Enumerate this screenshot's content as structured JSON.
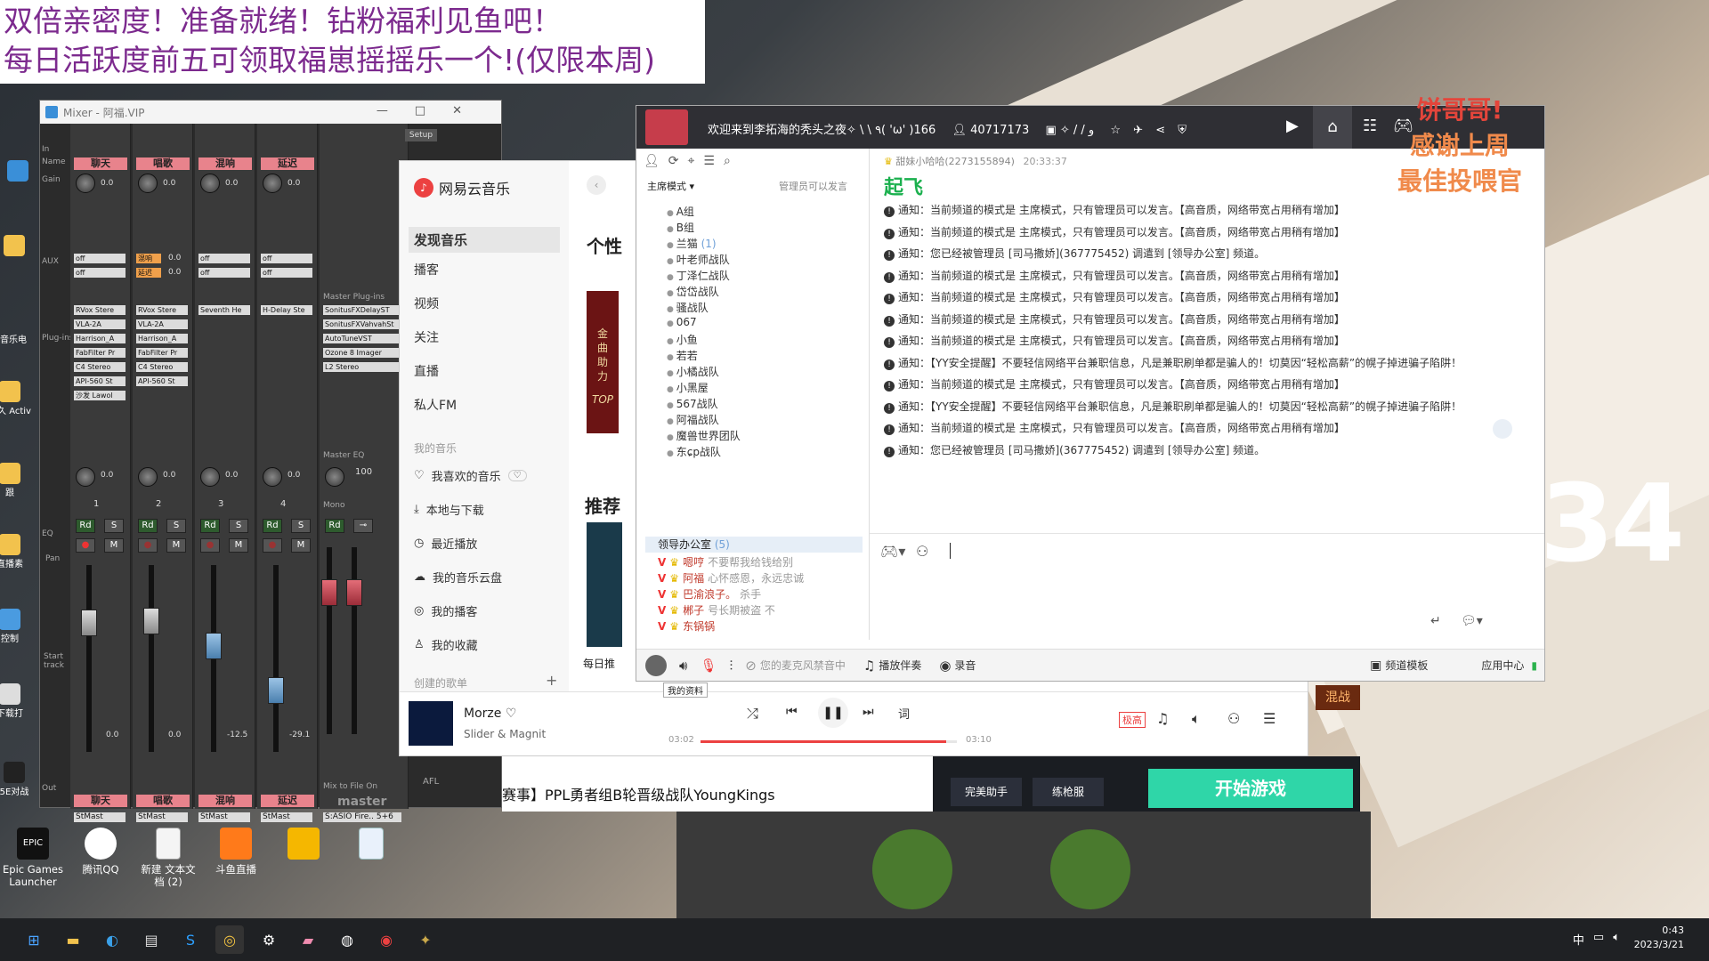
{
  "banner": {
    "line1": "双倍亲密度！准备就绪！钻粉福利见鱼吧！",
    "line2": "每日活跃度前五可领取福崽摇摇乐一个!(仅限本周)"
  },
  "overlay": {
    "line1": "饼哥哥!",
    "line2": "感谢上周",
    "line3": "最佳投喂官",
    "big_number": "34"
  },
  "desktop_icons": [
    {
      "label": "Epic Games Launcher",
      "icon": "epic-icon"
    },
    {
      "label": "腾讯QQ",
      "icon": "qq-icon"
    },
    {
      "label": "新建 文本文档 (2)",
      "icon": "text-file-icon"
    },
    {
      "label": "斗鱼直播",
      "icon": "douyu-icon"
    }
  ],
  "left_edge_labels": [
    "音乐电",
    "永久 Activ",
    "跟",
    "直播素",
    "控制",
    "下载打",
    "5E对战"
  ],
  "mixer": {
    "title": "Mixer - 阿福.VIP",
    "setup_label": "Setup",
    "row_labels": {
      "in": "In",
      "name": "Name",
      "gain": "Gain",
      "aux": "AUX",
      "plugins": "Plug-ins",
      "eq": "EQ",
      "pan": "Pan",
      "start_track": "Start track",
      "out": "Out"
    },
    "channels": [
      {
        "name": "聊天",
        "gain": "0.0",
        "aux": [
          "off",
          "off"
        ],
        "plugins": [
          "RVox Stere",
          "VLA-2A",
          "Harrison_A",
          "FabFilter Pr",
          "C4 Stereo",
          "API-560 St",
          "沙发 Lawol"
        ],
        "pan": "0.0",
        "num": "1",
        "level": "0.0",
        "out": "StMast"
      },
      {
        "name": "唱歌",
        "gain": "0.0",
        "aux": [
          "混响",
          "延迟"
        ],
        "aux_vals": [
          "0.0",
          "0.0"
        ],
        "plugins": [
          "RVox Stere",
          "VLA-2A",
          "Harrison_A",
          "FabFilter Pr",
          "C4 Stereo",
          "API-560 St"
        ],
        "pan": "0.0",
        "num": "2",
        "level": "0.0",
        "out": "StMast"
      },
      {
        "name": "混响",
        "gain": "0.0",
        "aux": [
          "off",
          "off"
        ],
        "plugins": [
          "Seventh He"
        ],
        "pan": "0.0",
        "num": "3",
        "level": "-12.5",
        "out": "StMast"
      },
      {
        "name": "延迟",
        "gain": "0.0",
        "aux": [
          "off",
          "off"
        ],
        "plugins": [
          "H-Delay Ste"
        ],
        "pan": "0.0",
        "num": "4",
        "level": "-29.1",
        "out": "StMast"
      }
    ],
    "master": {
      "plugins_label": "Master Plug-ins",
      "plugins": [
        "SonitusFXDelayST",
        "SonitusFXVahvahSt",
        "AutoTuneVST",
        "Ozone 8 Imager",
        "L2 Stereo"
      ],
      "eq_label": "Master EQ",
      "pan": "100",
      "mono_label": "Mono",
      "name": "master",
      "out": "S:ASIO Fire.. 5+6",
      "afl": "AFL",
      "mix_label": "Mix to File  On"
    }
  },
  "netease": {
    "logo": "网易云音乐",
    "nav": [
      "发现音乐",
      "播客",
      "视频",
      "关注",
      "直播",
      "私人FM"
    ],
    "my_music_label": "我的音乐",
    "my_music": [
      "我喜欢的音乐",
      "本地与下载",
      "最近播放",
      "我的音乐云盘",
      "我的播客",
      "我的收藏"
    ],
    "created_label": "创建的歌单",
    "main_heading_1": "个性",
    "main_heading_2": "推荐",
    "daily_label": "每日推",
    "promo_text": [
      "金",
      "曲",
      "助",
      "力"
    ],
    "promo_top": "TOP",
    "player": {
      "track": "Morze",
      "artist": "Slider & Magnit",
      "time_current": "03:02",
      "time_total": "03:10",
      "progress": 0.958,
      "quality": "极高",
      "lyrics_label": "词"
    }
  },
  "yy": {
    "title": "欢迎来到李拓海的秃头之夜✧ \\ \\ ٩( 'ω' )و / / ✧",
    "room_id": "40717173",
    "users": "166",
    "mode_label": "主席模式",
    "admin_only": "管理员可以发言",
    "channels": [
      "A组",
      "B组",
      "兰猫",
      "叶老师战队",
      "丁泽仁战队",
      "岱岱战队",
      "骚战队",
      "067",
      "小鱼",
      "若若",
      "小橘战队",
      "小黑屋",
      "567战队",
      "阿福战队",
      "魔兽世界团队",
      "东ɕp战队"
    ],
    "channel_counts": {
      "兰猫": "(1)"
    },
    "office": {
      "name": "领导办公室",
      "count": "(5)"
    },
    "members": [
      {
        "name": "嗯哼",
        "note": "不要帮我给钱给别"
      },
      {
        "name": "阿福",
        "note": "心怀感恩，永远忠诚"
      },
      {
        "name": "巴渝浪子。",
        "note": "杀手"
      },
      {
        "name": "郴子",
        "note": "号长期被盗 不"
      },
      {
        "name": "东锅锅",
        "note": ""
      }
    ],
    "chat": {
      "sender": "甜妹小哈哈(2273155894)",
      "time": "20:33:37",
      "message": "起飞",
      "notices": [
        "通知：当前频道的模式是 主席模式，只有管理员可以发言。【高音质，网络带宽占用稍有增加】",
        "通知：当前频道的模式是 主席模式，只有管理员可以发言。【高音质，网络带宽占用稍有增加】",
        "通知：您已经被管理员 [司马撒娇](367775452) 调遣到 [领导办公室] 频道。",
        "通知：当前频道的模式是 主席模式，只有管理员可以发言。【高音质，网络带宽占用稍有增加】",
        "通知：当前频道的模式是 主席模式，只有管理员可以发言。【高音质，网络带宽占用稍有增加】",
        "通知：当前频道的模式是 主席模式，只有管理员可以发言。【高音质，网络带宽占用稍有增加】",
        "通知：当前频道的模式是 主席模式，只有管理员可以发言。【高音质，网络带宽占用稍有增加】",
        "通知：【YY安全提醒】不要轻信网络平台兼职信息，凡是兼职刷单都是骗人的！切莫因“轻松高薪”的幌子掉进骗子陷阱！",
        "通知：当前频道的模式是 主席模式，只有管理员可以发言。【高音质，网络带宽占用稍有增加】",
        "通知：【YY安全提醒】不要轻信网络平台兼职信息，凡是兼职刷单都是骗人的！切莫因“轻松高薪”的幌子掉进骗子陷阱！",
        "通知：当前频道的模式是 主席模式，只有管理员可以发言。【高音质，网络带宽占用稍有增加】",
        "通知：您已经被管理员 [司马撒娇](367775452) 调遣到 [领导办公室] 频道。"
      ]
    },
    "bottom": {
      "mic_muted": "您的麦克风禁音中",
      "accompany": "播放伴奏",
      "record": "录音",
      "template": "频道模板",
      "app_center": "应用中心",
      "tooltip": "我的资料"
    }
  },
  "bottom_strip": {
    "news": "赛事】PPL勇者组B轮晋级战队YoungKings",
    "tool1": "完美助手",
    "tool2": "练枪服",
    "start_game": "开始游戏",
    "tag": "混战"
  },
  "clock": {
    "time": "0:43",
    "date": "2023/3/21"
  },
  "tray": {
    "ime": "中"
  },
  "colors": {
    "mixer_name": "#e8838c",
    "yy_head": "#2f2f34",
    "netease_red": "#ec4141",
    "banner_text": "#7c2a8e"
  }
}
